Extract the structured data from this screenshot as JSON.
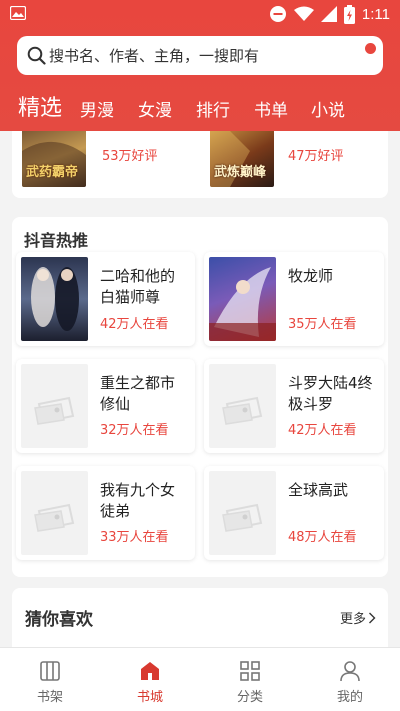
{
  "status_bar": {
    "time": "1:11"
  },
  "search": {
    "placeholder": "搜书名、作者、主角，一搜即有"
  },
  "tabs": [
    {
      "label": "精选",
      "active": true
    },
    {
      "label": "男漫"
    },
    {
      "label": "女漫"
    },
    {
      "label": "排行"
    },
    {
      "label": "书单"
    },
    {
      "label": "小说"
    }
  ],
  "top_books": [
    {
      "cover_text": "武药霸帝",
      "stat": "53万好评"
    },
    {
      "cover_text": "武炼巅峰",
      "stat": "47万好评"
    }
  ],
  "douyin": {
    "title": "抖音热推",
    "books": [
      {
        "title": "二哈和他的白猫师尊",
        "stat": "42万人在看"
      },
      {
        "title": "牧龙师",
        "stat": "35万人在看"
      },
      {
        "title": "重生之都市修仙",
        "stat": "32万人在看"
      },
      {
        "title": "斗罗大陆4终极斗罗",
        "stat": "42万人在看"
      },
      {
        "title": "我有九个女徒弟",
        "stat": "33万人在看"
      },
      {
        "title": "全球高武",
        "stat": "48万人在看"
      }
    ]
  },
  "guess": {
    "title": "猜你喜欢",
    "more_label": "更多"
  },
  "bottom_nav": [
    {
      "label": "书架",
      "icon": "bookshelf-icon"
    },
    {
      "label": "书城",
      "icon": "store-icon",
      "active": true
    },
    {
      "label": "分类",
      "icon": "category-icon"
    },
    {
      "label": "我的",
      "icon": "profile-icon"
    }
  ],
  "colors": {
    "brand": "#e8463e",
    "stat": "#e8463e",
    "nav_active": "#d8392f"
  }
}
